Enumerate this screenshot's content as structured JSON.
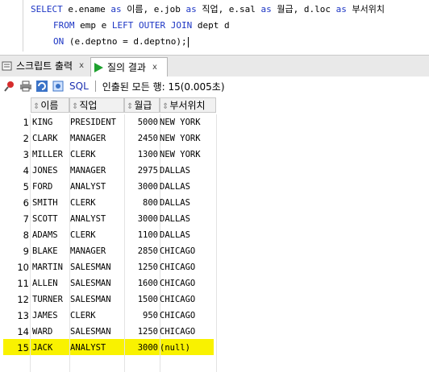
{
  "editor": {
    "line1": [
      {
        "t": "SELECT",
        "k": 1
      },
      {
        "t": " e.ename ",
        "k": 0
      },
      {
        "t": "as",
        "k": 1
      },
      {
        "t": " 이름, e.job ",
        "k": 0
      },
      {
        "t": "as",
        "k": 1
      },
      {
        "t": " 직업, e.sal ",
        "k": 0
      },
      {
        "t": "as",
        "k": 1
      },
      {
        "t": " 월급, d.loc ",
        "k": 0
      },
      {
        "t": "as",
        "k": 1
      },
      {
        "t": " 부서위치",
        "k": 0
      }
    ],
    "line2": [
      {
        "t": "FROM",
        "k": 1
      },
      {
        "t": " emp e ",
        "k": 0
      },
      {
        "t": "LEFT OUTER JOIN",
        "k": 1
      },
      {
        "t": " dept d",
        "k": 0
      }
    ],
    "line3": [
      {
        "t": "ON",
        "k": 1
      },
      {
        "t": " (e.deptno = d.deptno);",
        "k": 0
      }
    ]
  },
  "tabs": [
    {
      "label": "스크립트 출력",
      "close": "x",
      "icon": "script-output-icon"
    },
    {
      "label": "질의 결과",
      "close": "x",
      "icon": "run-query-icon"
    }
  ],
  "toolbar": {
    "sql_label": "SQL",
    "status": "인출된 모든 행: 15(0.005초)"
  },
  "columns": [
    "이름",
    "직업",
    "월급",
    "부서위치"
  ],
  "rows": [
    [
      "1",
      "KING",
      "PRESIDENT",
      "5000",
      "NEW YORK"
    ],
    [
      "2",
      "CLARK",
      "MANAGER",
      "2450",
      "NEW YORK"
    ],
    [
      "3",
      "MILLER",
      "CLERK",
      "1300",
      "NEW YORK"
    ],
    [
      "4",
      "JONES",
      "MANAGER",
      "2975",
      "DALLAS"
    ],
    [
      "5",
      "FORD",
      "ANALYST",
      "3000",
      "DALLAS"
    ],
    [
      "6",
      "SMITH",
      "CLERK",
      "800",
      "DALLAS"
    ],
    [
      "7",
      "SCOTT",
      "ANALYST",
      "3000",
      "DALLAS"
    ],
    [
      "8",
      "ADAMS",
      "CLERK",
      "1100",
      "DALLAS"
    ],
    [
      "9",
      "BLAKE",
      "MANAGER",
      "2850",
      "CHICAGO"
    ],
    [
      "10",
      "MARTIN",
      "SALESMAN",
      "1250",
      "CHICAGO"
    ],
    [
      "11",
      "ALLEN",
      "SALESMAN",
      "1600",
      "CHICAGO"
    ],
    [
      "12",
      "TURNER",
      "SALESMAN",
      "1500",
      "CHICAGO"
    ],
    [
      "13",
      "JAMES",
      "CLERK",
      "950",
      "CHICAGO"
    ],
    [
      "14",
      "WARD",
      "SALESMAN",
      "1250",
      "CHICAGO"
    ],
    [
      "15",
      "JACK",
      "ANALYST",
      "3000",
      "(null)"
    ]
  ],
  "highlight_color": "#f9f200",
  "keyword_color": "#1c35c4"
}
